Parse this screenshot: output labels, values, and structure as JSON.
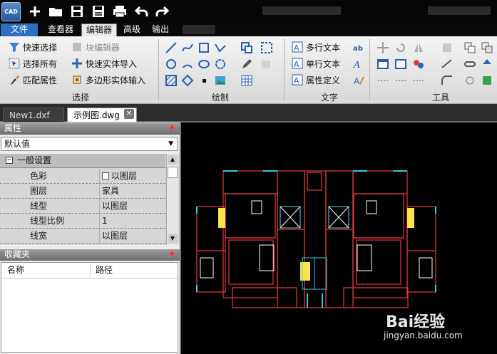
{
  "app": {
    "logo_text": "CAD"
  },
  "menu": {
    "file": "文件",
    "viewer": "查看器",
    "editor": "编辑器",
    "advanced": "高级",
    "output": "输出"
  },
  "ribbon": {
    "select_group": {
      "label": "选择",
      "quick_select": "快速选择",
      "block_editor": "块编辑器",
      "select_all": "选择所有",
      "quick_entity_import": "快速实体导入",
      "match_props": "匹配属性",
      "polygon_entity_input": "多边形实体输入"
    },
    "draw_group": {
      "label": "绘制"
    },
    "text_group": {
      "label": "文字",
      "mtext": "多行文本",
      "stext": "单行文本",
      "attdef": "属性定义"
    },
    "tools_group": {
      "label": "工具"
    }
  },
  "tabs": [
    {
      "label": "New1.dxf"
    },
    {
      "label": "示例图.dwg"
    }
  ],
  "properties": {
    "header": "属性",
    "dropdown_value": "默认值",
    "section": "一般设置",
    "rows": [
      {
        "key": "色彩",
        "value": "以图层"
      },
      {
        "key": "图层",
        "value": "家具"
      },
      {
        "key": "线型",
        "value": "以图层"
      },
      {
        "key": "线型比例",
        "value": "1"
      },
      {
        "key": "线宽",
        "value": "以图层"
      }
    ]
  },
  "favorites": {
    "header": "收藏夹",
    "col_name": "名称",
    "col_path": "路径"
  },
  "watermark": {
    "brand": "Bai经验",
    "url": "jingyan.baidu.com"
  },
  "colors": {
    "ribbon_bg": "#e6e6e6",
    "menu_file": "#2f6fc0",
    "canvas": "#000000",
    "wall": "#e33b3b",
    "wall_cyan": "#2ecde0"
  }
}
